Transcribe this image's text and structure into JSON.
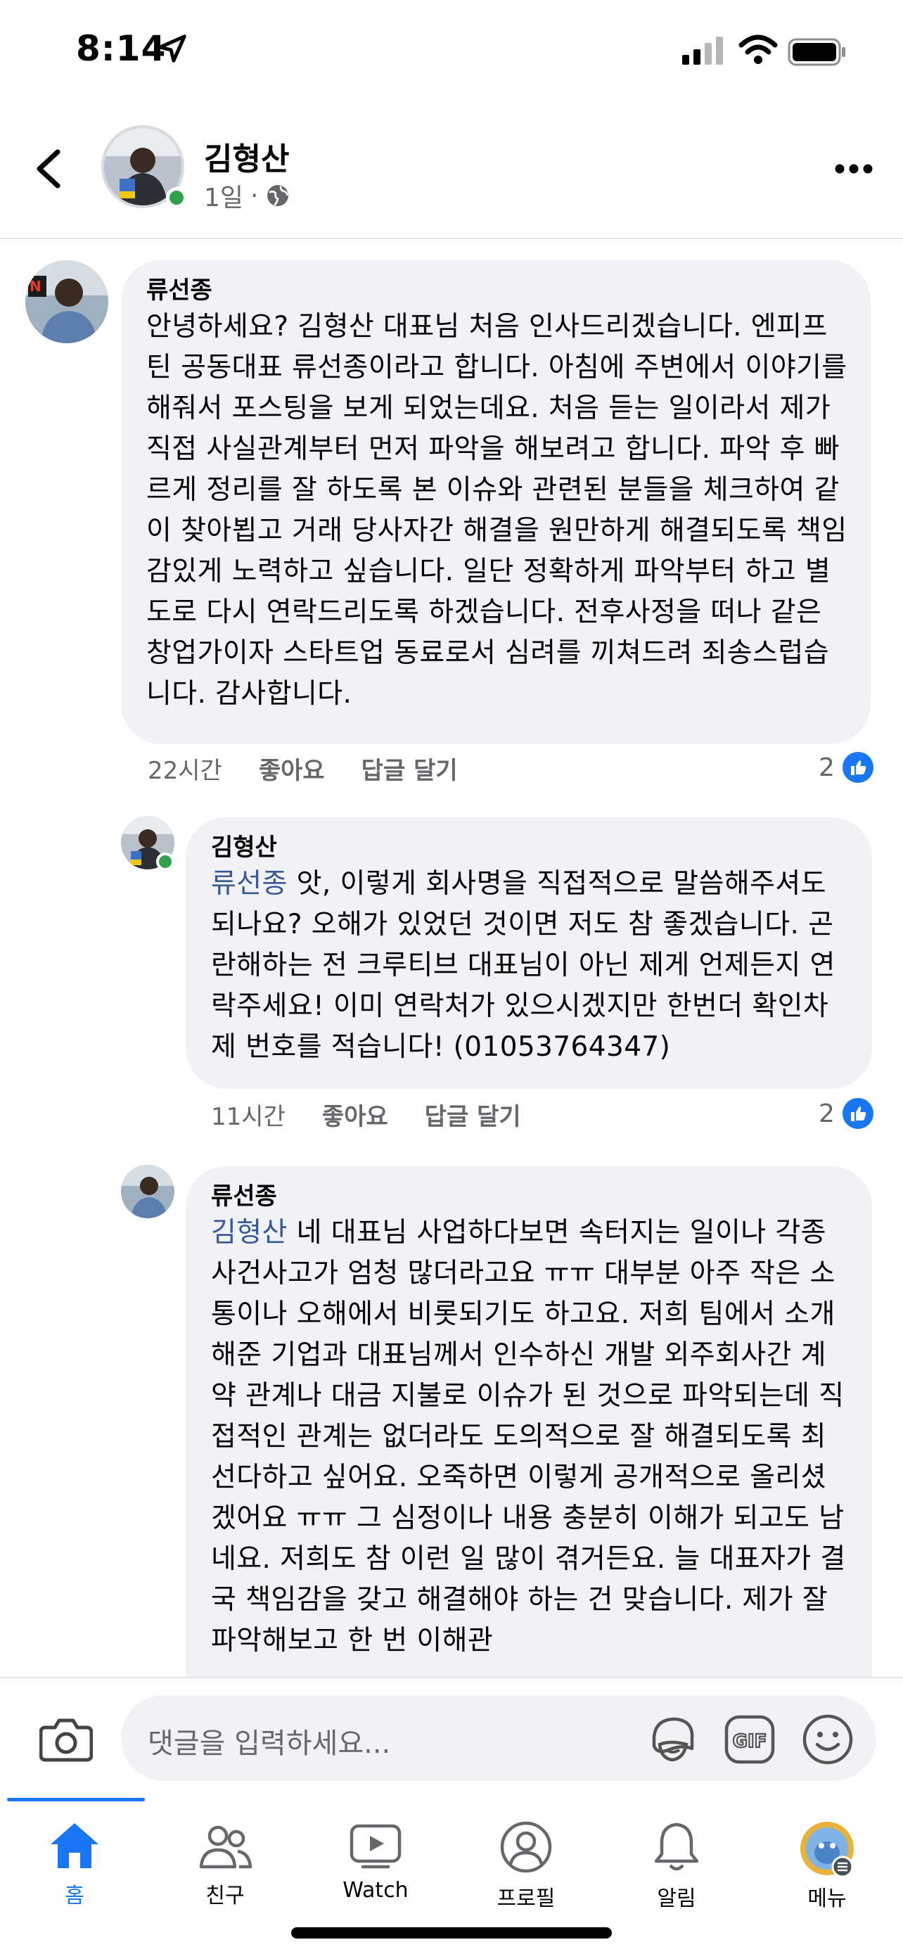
{
  "status_bar": {
    "time": "8:14"
  },
  "header": {
    "name": "김형산",
    "time": "1일",
    "separator": "·"
  },
  "comments": [
    {
      "author": "류선종",
      "mention": "",
      "text": "안녕하세요? 김형산 대표님 처음 인사드리겠습니다. 엔피프틴 공동대표 류선종이라고 합니다. 아침에 주변에서 이야기를 해줘서 포스팅을 보게 되었는데요. 처음 듣는 일이라서 제가 직접 사실관계부터 먼저 파악을 해보려고 합니다. 파악 후 빠르게 정리를 잘 하도록 본 이슈와 관련된 분들을 체크하여 같이 찾아뵙고 거래 당사자간 해결을 원만하게 해결되도록 책임감있게 노력하고 싶습니다. 일단 정확하게 파악부터 하고 별도로 다시 연락드리도록 하겠습니다. 전후사정을 떠나 같은 창업가이자 스타트업 동료로서 심려를 끼쳐드려 죄송스럽습니다. 감사합니다.",
      "time": "22시간",
      "like_label": "좋아요",
      "reply_label": "답글 달기",
      "like_count": "2"
    },
    {
      "author": "김형산",
      "mention": "류선종",
      "text": " 앗, 이렇게 회사명을 직접적으로 말씀해주셔도 되나요? 오해가 있었던 것이면 저도 참 좋겠습니다. 곤란해하는 전 크루티브 대표님이 아닌 제게 언제든지 연락주세요! 이미 연락처가 있으시겠지만 한번더 확인차 제 번호를 적습니다! (01053764347)",
      "time": "11시간",
      "like_label": "좋아요",
      "reply_label": "답글 달기",
      "like_count": "2"
    },
    {
      "author": "류선종",
      "mention": "김형산",
      "text": " 네 대표님 사업하다보면 속터지는 일이나 각종 사건사고가 엄청 많더라고요 ㅠㅠ 대부분 아주 작은 소통이나 오해에서 비롯되기도 하고요. 저희 팀에서 소개해준 기업과 대표님께서 인수하신 개발 외주회사간 계약 관계나 대금 지불로 이슈가 된 것으로 파악되는데 직접적인 관계는 없더라도 도의적으로 잘 해결되도록 최선다하고 싶어요. 오죽하면 이렇게 공개적으로 올리셨겠어요 ㅠㅠ 그 심정이나 내용 충분히 이해가 되고도 남네요. 저희도 참 이런 일 많이 겪거든요. 늘 대표자가 결국 책임감을 갖고 해결해야 하는 건 맞습니다. 제가 잘 파악해보고 한 번 이해관"
    }
  ],
  "comment_input": {
    "placeholder": "댓글을 입력하세요..."
  },
  "tabs": [
    {
      "label": "홈",
      "icon": "home-icon",
      "active": true
    },
    {
      "label": "친구",
      "icon": "friends-icon"
    },
    {
      "label": "Watch",
      "icon": "watch-icon"
    },
    {
      "label": "프로필",
      "icon": "profile-icon"
    },
    {
      "label": "알림",
      "icon": "bell-icon"
    },
    {
      "label": "메뉴",
      "icon": "menu-avatar-icon"
    }
  ],
  "colors": {
    "accent": "#1877f2",
    "bubble": "#f0f2f5",
    "mention": "#385898",
    "online": "#31a24c",
    "secondary_text": "#65676b"
  }
}
